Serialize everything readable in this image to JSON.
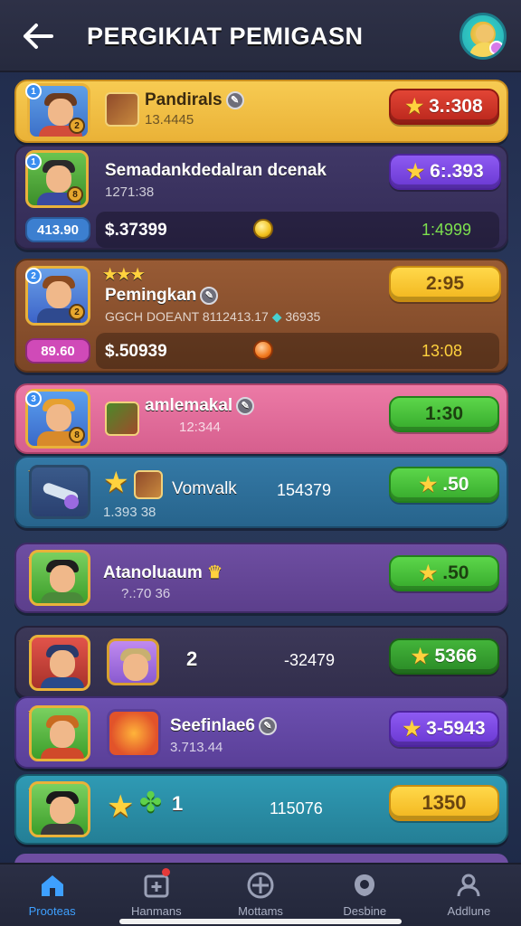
{
  "header": {
    "title": "PERGIKIAT PEMIGASN"
  },
  "rows": [
    {
      "name": "Pandirals",
      "sub": "13.4445",
      "score": "3.:308",
      "color": "#f1bb3e"
    },
    {
      "name": "Semadankdedalran dcenak",
      "sub": "1271:38",
      "score": "6:.393",
      "chip": "413.90",
      "strip_value": "$.37399",
      "strip_right": "1:4999",
      "color": "#3d3560"
    },
    {
      "name": "Pemingkan",
      "sub": "GGCH DOEANT 8112413.17",
      "sub2": "36935",
      "score": "2:95",
      "chip": "89.60",
      "strip_value": "$.50939",
      "strip_right": "13:08",
      "stars": "★★★",
      "color": "#8a5232"
    },
    {
      "name": "amlemakal",
      "sub": "12:344",
      "score": "1:30",
      "color": "#e16c98"
    },
    {
      "name": "Vomvalk",
      "sub": "1.393 38",
      "mid": "154379",
      "score": ".50",
      "color": "#2f6d97"
    },
    {
      "name": "Atanoluaum",
      "sub": "?.:70 36",
      "score": ".50",
      "color": "#6a4a9a"
    },
    {
      "name": "2",
      "mid": "-32479",
      "score": "5366",
      "color": "#3a3758"
    },
    {
      "name": "Seefinlae6",
      "sub": "3.713.44",
      "score": "3-5943",
      "color": "#6348a6"
    },
    {
      "name": "1",
      "mid": "115076",
      "score": "1350",
      "color": "#2a8fa8"
    }
  ],
  "nav": {
    "items": [
      {
        "label": "Prooteas",
        "icon": "home-icon"
      },
      {
        "label": "Hanmans",
        "icon": "calendar-plus-icon"
      },
      {
        "label": "Mottams",
        "icon": "compass-icon"
      },
      {
        "label": "Desbine",
        "icon": "shield-icon"
      },
      {
        "label": "Addlune",
        "icon": "user-icon"
      }
    ]
  }
}
